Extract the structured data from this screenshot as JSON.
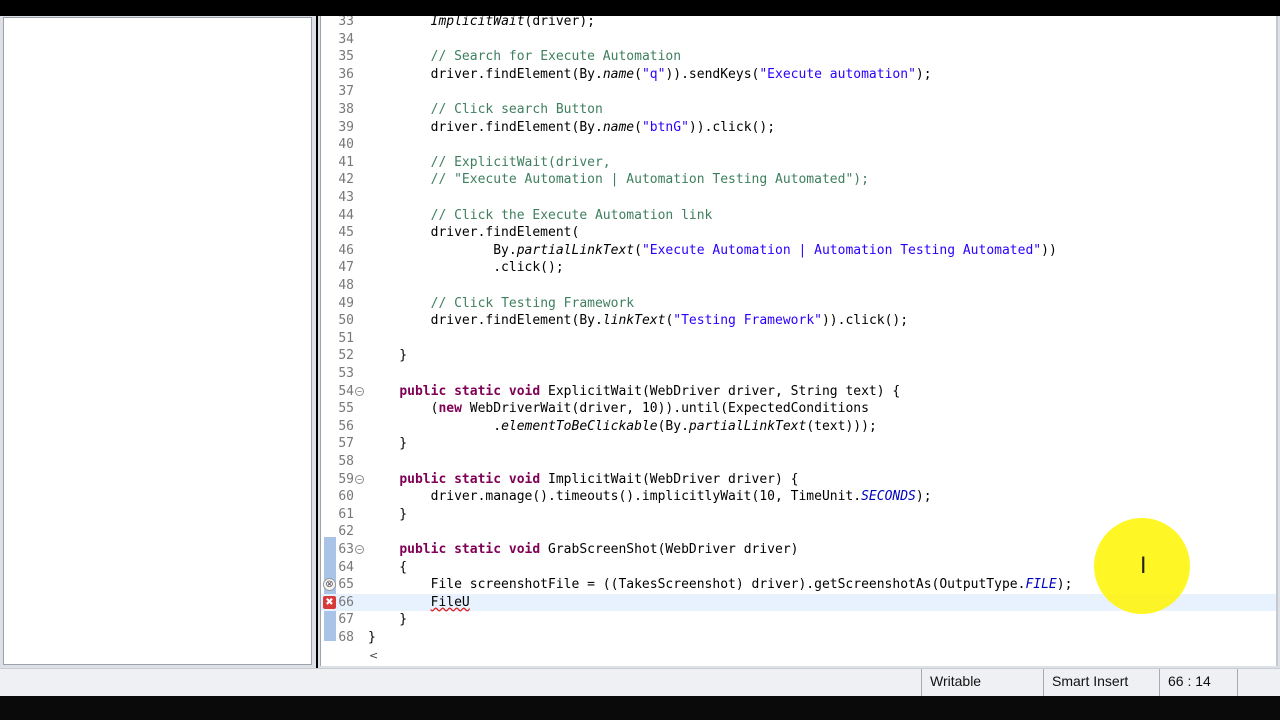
{
  "editor": {
    "lines": [
      {
        "num": "33",
        "segs": [
          [
            "",
            "        "
          ],
          [
            "it",
            "ImplicitWait"
          ],
          [
            "",
            "(driver);"
          ]
        ]
      },
      {
        "num": "34",
        "segs": []
      },
      {
        "num": "35",
        "segs": [
          [
            "",
            "        "
          ],
          [
            "cm",
            "// Search for Execute Automation"
          ]
        ]
      },
      {
        "num": "36",
        "segs": [
          [
            "",
            "        driver.findElement(By."
          ],
          [
            "it",
            "name"
          ],
          [
            "",
            "("
          ],
          [
            "str",
            "\"q\""
          ],
          [
            "",
            ")).sendKeys("
          ],
          [
            "str",
            "\"Execute automation\""
          ],
          [
            "",
            ");"
          ]
        ]
      },
      {
        "num": "37",
        "segs": []
      },
      {
        "num": "38",
        "segs": [
          [
            "",
            "        "
          ],
          [
            "cm",
            "// Click search Button"
          ]
        ]
      },
      {
        "num": "39",
        "segs": [
          [
            "",
            "        driver.findElement(By."
          ],
          [
            "it",
            "name"
          ],
          [
            "",
            "("
          ],
          [
            "str",
            "\"btnG\""
          ],
          [
            "",
            ")).click();"
          ]
        ]
      },
      {
        "num": "40",
        "segs": []
      },
      {
        "num": "41",
        "segs": [
          [
            "",
            "        "
          ],
          [
            "cm",
            "// ExplicitWait(driver,"
          ]
        ]
      },
      {
        "num": "42",
        "segs": [
          [
            "",
            "        "
          ],
          [
            "cm",
            "// \"Execute Automation | Automation Testing Automated\");"
          ]
        ]
      },
      {
        "num": "43",
        "segs": []
      },
      {
        "num": "44",
        "segs": [
          [
            "",
            "        "
          ],
          [
            "cm",
            "// Click the Execute Automation link"
          ]
        ]
      },
      {
        "num": "45",
        "segs": [
          [
            "",
            "        driver.findElement("
          ]
        ]
      },
      {
        "num": "46",
        "segs": [
          [
            "",
            "                By."
          ],
          [
            "it",
            "partialLinkText"
          ],
          [
            "",
            "("
          ],
          [
            "str",
            "\"Execute Automation | Automation Testing Automated\""
          ],
          [
            "",
            "))"
          ]
        ]
      },
      {
        "num": "47",
        "segs": [
          [
            "",
            "                .click();"
          ]
        ]
      },
      {
        "num": "48",
        "segs": []
      },
      {
        "num": "49",
        "segs": [
          [
            "",
            "        "
          ],
          [
            "cm",
            "// Click Testing Framework"
          ]
        ]
      },
      {
        "num": "50",
        "segs": [
          [
            "",
            "        driver.findElement(By."
          ],
          [
            "it",
            "linkText"
          ],
          [
            "",
            "("
          ],
          [
            "str",
            "\"Testing Framework\""
          ],
          [
            "",
            ")).click();"
          ]
        ]
      },
      {
        "num": "51",
        "segs": []
      },
      {
        "num": "52",
        "segs": [
          [
            "",
            "    }"
          ]
        ]
      },
      {
        "num": "53",
        "segs": []
      },
      {
        "num": "54",
        "fold": true,
        "segs": [
          [
            "",
            "    "
          ],
          [
            "kw",
            "public static void"
          ],
          [
            "",
            " ExplicitWait(WebDriver driver, String text) {"
          ]
        ]
      },
      {
        "num": "55",
        "segs": [
          [
            "",
            "        ("
          ],
          [
            "kw",
            "new"
          ],
          [
            "",
            " WebDriverWait(driver, 10)).until(ExpectedConditions"
          ]
        ]
      },
      {
        "num": "56",
        "segs": [
          [
            "",
            "                ."
          ],
          [
            "it",
            "elementToBeClickable"
          ],
          [
            "",
            "(By."
          ],
          [
            "it",
            "partialLinkText"
          ],
          [
            "",
            "(text)));"
          ]
        ]
      },
      {
        "num": "57",
        "segs": [
          [
            "",
            "    }"
          ]
        ]
      },
      {
        "num": "58",
        "segs": []
      },
      {
        "num": "59",
        "fold": true,
        "segs": [
          [
            "",
            "    "
          ],
          [
            "kw",
            "public static void"
          ],
          [
            "",
            " ImplicitWait(WebDriver driver) {"
          ]
        ]
      },
      {
        "num": "60",
        "segs": [
          [
            "",
            "        driver.manage().timeouts().implicitlyWait(10, TimeUnit."
          ],
          [
            "cst",
            "SECONDS"
          ],
          [
            "",
            ");"
          ]
        ]
      },
      {
        "num": "61",
        "segs": [
          [
            "",
            "    }"
          ]
        ]
      },
      {
        "num": "62",
        "segs": []
      },
      {
        "num": "63",
        "fold": true,
        "segs": [
          [
            "",
            "    "
          ],
          [
            "kw",
            "public static void"
          ],
          [
            "",
            " GrabScreenShot(WebDriver driver)"
          ]
        ]
      },
      {
        "num": "64",
        "segs": [
          [
            "",
            "    {"
          ]
        ]
      },
      {
        "num": "65",
        "ann": "warn",
        "segs": [
          [
            "",
            "        File screenshotFile = ((TakesScreenshot) driver).getScreenshotAs(OutputType."
          ],
          [
            "cst",
            "FILE"
          ],
          [
            "",
            ");"
          ]
        ]
      },
      {
        "num": "66",
        "ann": "error",
        "current": true,
        "segs": [
          [
            "",
            "        "
          ],
          [
            "err",
            "FileU"
          ]
        ]
      },
      {
        "num": "67",
        "segs": [
          [
            "",
            "    }"
          ]
        ]
      },
      {
        "num": "68",
        "segs": [
          [
            "",
            "}"
          ]
        ]
      }
    ],
    "hscroll_arrow": "<"
  },
  "status": {
    "writable": "Writable",
    "insert_mode": "Smart Insert",
    "position": "66 : 14"
  },
  "icons": {
    "fold": "collapse-icon",
    "error": "error-icon",
    "warning": "warning-icon",
    "cursor": "ibeam-cursor-icon"
  },
  "colors": {
    "keyword": "#7f0055",
    "comment": "#3f7f5f",
    "string": "#2a00ff",
    "constant": "#0000c0",
    "current_line": "#e8f2fe",
    "cursor_highlight": "#fff500"
  }
}
